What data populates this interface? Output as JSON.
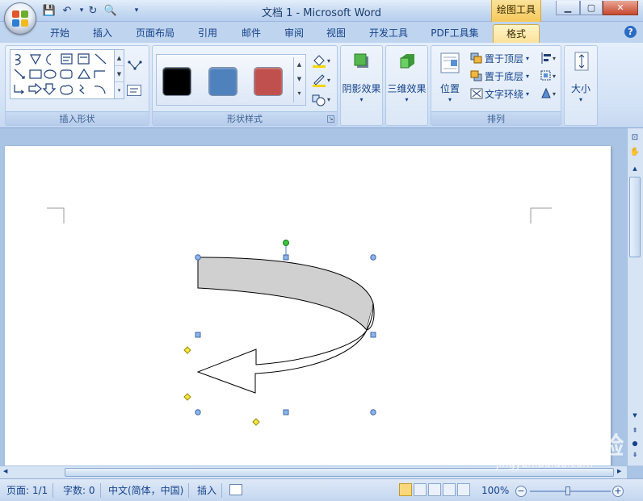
{
  "window": {
    "title": "文档 1 - Microsoft Word",
    "context_tab_title": "绘图工具"
  },
  "tabs": [
    {
      "label": "开始"
    },
    {
      "label": "插入"
    },
    {
      "label": "页面布局"
    },
    {
      "label": "引用"
    },
    {
      "label": "邮件"
    },
    {
      "label": "审阅"
    },
    {
      "label": "视图"
    },
    {
      "label": "开发工具"
    },
    {
      "label": "PDF工具集"
    },
    {
      "label": "格式"
    }
  ],
  "ribbon": {
    "insert_shapes": {
      "label": "插入形状"
    },
    "shape_styles": {
      "label": "形状样式",
      "swatches": [
        "#000000",
        "#4f81bd",
        "#c0504d"
      ]
    },
    "shadow_effects": {
      "label": "阴影效果"
    },
    "3d_effects": {
      "label": "三维效果"
    },
    "arrange": {
      "label": "排列",
      "position": "位置",
      "bring_front": "置于顶层",
      "send_back": "置于底层",
      "text_wrap": "文字环绕"
    },
    "size": {
      "label": "大小"
    }
  },
  "status": {
    "page": "页面: 1/1",
    "words": "字数: 0",
    "language": "中文(简体，中国)",
    "mode": "插入",
    "zoom": "100%"
  },
  "watermark": {
    "brand": "Baidu经验",
    "url": "jingyan.baidu.com"
  },
  "colors": {
    "shape_fill": "#d0d0d0",
    "accent_tab": "#fbe29a"
  }
}
